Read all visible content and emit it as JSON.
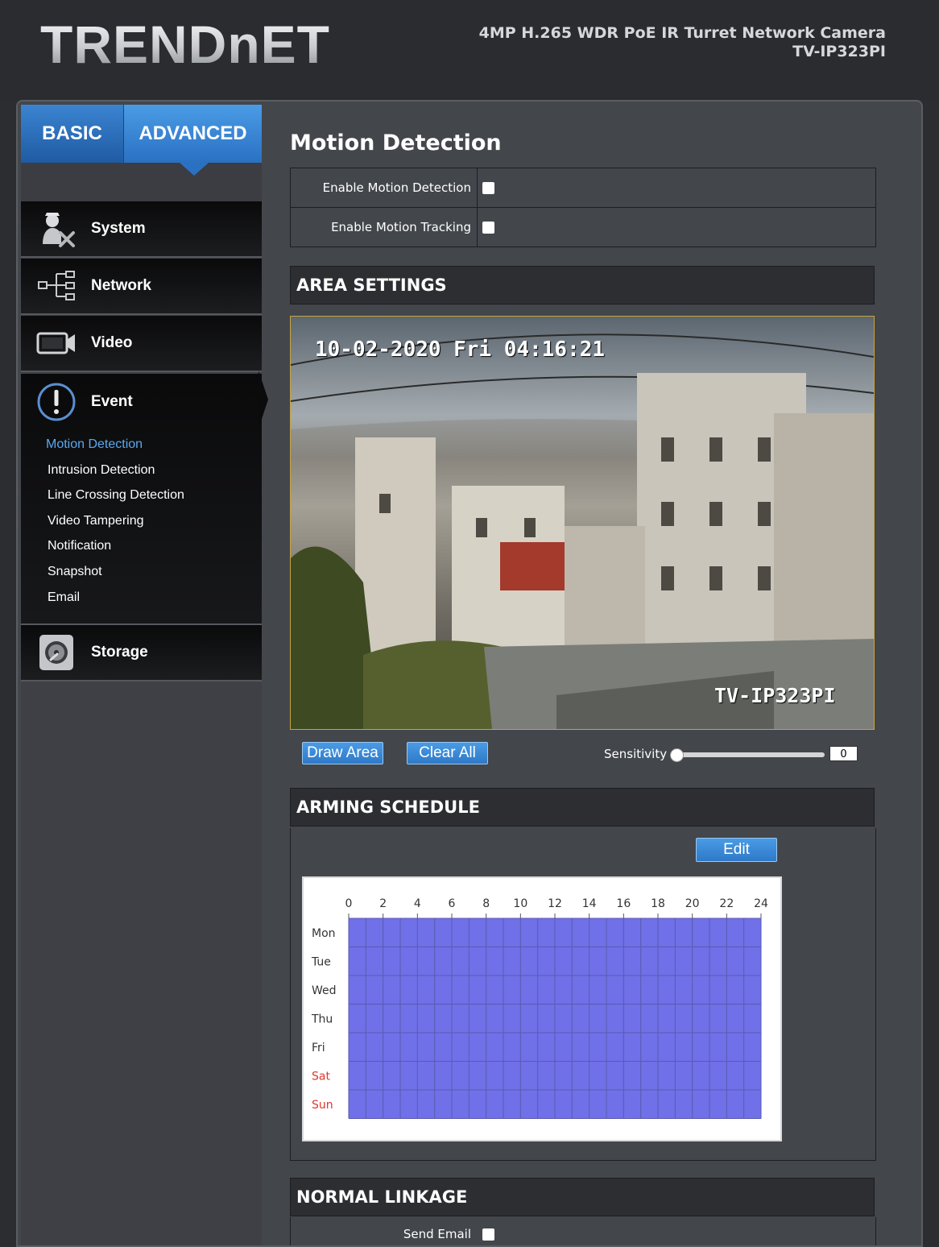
{
  "brand": {
    "logo_text": "TRENDnET"
  },
  "product": {
    "line1": "4MP H.265 WDR PoE IR Turret Network Camera",
    "line2": "TV-IP323PI"
  },
  "tabs": {
    "basic": "BASIC",
    "advanced": "ADVANCED"
  },
  "nav": {
    "system": "System",
    "network": "Network",
    "video": "Video",
    "event": "Event",
    "storage": "Storage",
    "event_items": [
      "Motion Detection",
      "Intrusion Detection",
      "Line Crossing Detection",
      "Video Tampering",
      "Notification",
      "Snapshot",
      "Email"
    ]
  },
  "page": {
    "title": "Motion Detection",
    "enable_motion_label": "Enable Motion Detection",
    "enable_tracking_label": "Enable Motion Tracking",
    "enable_motion_checked": false,
    "enable_tracking_checked": false
  },
  "area": {
    "heading": "AREA SETTINGS",
    "osd_timestamp": "10-02-2020 Fri 04:16:21",
    "osd_camera": "TV-IP323PI",
    "draw_button": "Draw Area",
    "clear_button": "Clear All",
    "sensitivity_label": "Sensitivity",
    "sensitivity_value": "0"
  },
  "schedule": {
    "heading": "ARMING SCHEDULE",
    "edit_button": "Edit",
    "hours": [
      "0",
      "2",
      "4",
      "6",
      "8",
      "10",
      "12",
      "14",
      "16",
      "18",
      "20",
      "22",
      "24"
    ],
    "days": [
      "Mon",
      "Tue",
      "Wed",
      "Thu",
      "Fri",
      "Sat",
      "Sun"
    ],
    "weekend_days": [
      "Sat",
      "Sun"
    ],
    "armed_color": "#7070e8",
    "weekend_color": "#e0362c"
  },
  "linkage": {
    "heading": "NORMAL LINKAGE",
    "send_email_label": "Send Email"
  }
}
